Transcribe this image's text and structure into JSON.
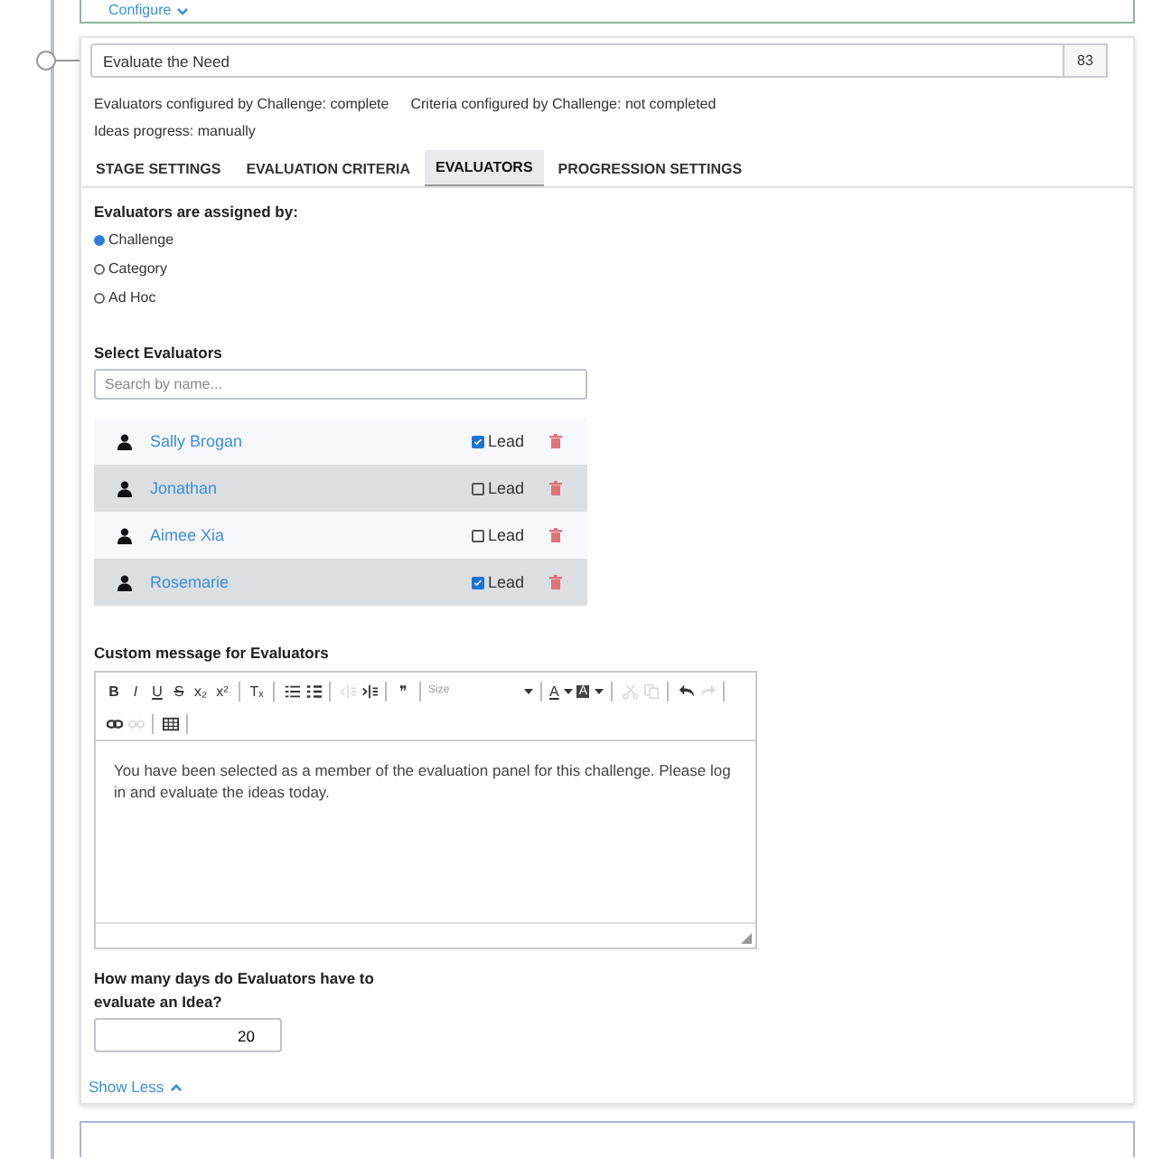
{
  "previous_card": {
    "link": "Configure"
  },
  "stage": {
    "title": "Evaluate the Need",
    "count": "83",
    "info": [
      "Evaluators configured by Challenge: complete",
      "Criteria configured by Challenge: not completed",
      "Ideas progress: manually"
    ],
    "tabs": [
      {
        "label": "STAGE SETTINGS",
        "selected": false
      },
      {
        "label": "EVALUATION CRITERIA",
        "selected": false
      },
      {
        "label": "EVALUATORS",
        "selected": true
      },
      {
        "label": "PROGRESSION SETTINGS",
        "selected": false
      }
    ],
    "assignment": {
      "label": "Evaluators are assigned by:",
      "options": [
        {
          "label": "Challenge",
          "selected": true
        },
        {
          "label": "Category",
          "selected": false
        },
        {
          "label": "Ad Hoc",
          "selected": false
        }
      ]
    },
    "select_label": "Select Evaluators",
    "search": {
      "placeholder": "Search by name..."
    },
    "evaluators": [
      {
        "name": "Sally Brogan",
        "lead": true,
        "lead_label": "Lead"
      },
      {
        "name": "Jonathan",
        "lead": false,
        "lead_label": "Lead"
      },
      {
        "name": "Aimee Xia",
        "lead": false,
        "lead_label": "Lead"
      },
      {
        "name": "Rosemarie",
        "lead": true,
        "lead_label": "Lead"
      }
    ],
    "message_label": "Custom message for Evaluators",
    "toolbar": [
      {
        "kind": "glyph",
        "label": "B",
        "disabled": false
      },
      {
        "kind": "glyph",
        "label": "I",
        "disabled": false
      },
      {
        "kind": "glyph",
        "label": "U",
        "disabled": false
      },
      {
        "kind": "glyph",
        "label": "S",
        "disabled": false
      },
      {
        "kind": "glyph",
        "label": "x₂",
        "disabled": false
      },
      {
        "kind": "glyph",
        "label": "x²",
        "disabled": false
      },
      {
        "kind": "sep"
      },
      {
        "kind": "glyph",
        "label": "Tₓ",
        "disabled": false
      },
      {
        "kind": "sep"
      },
      {
        "kind": "numbered",
        "disabled": false
      },
      {
        "kind": "bulleted",
        "disabled": false
      },
      {
        "kind": "sep"
      },
      {
        "kind": "outdent",
        "disabled": true
      },
      {
        "kind": "indent",
        "disabled": false
      },
      {
        "kind": "sep"
      },
      {
        "kind": "glyph",
        "label": "❞",
        "disabled": false
      },
      {
        "kind": "sep"
      },
      {
        "kind": "dropdown",
        "label": "Size",
        "disabled": false
      },
      {
        "kind": "sep"
      },
      {
        "kind": "color",
        "label": "A",
        "disabled": false
      },
      {
        "kind": "background",
        "label": "A",
        "disabled": false
      },
      {
        "kind": "sep"
      },
      {
        "kind": "cut",
        "disabled": true
      },
      {
        "kind": "copy",
        "disabled": true
      },
      {
        "kind": "sep"
      },
      {
        "kind": "undo",
        "disabled": false
      },
      {
        "kind": "redo",
        "disabled": true
      },
      {
        "kind": "sep"
      },
      {
        "kind": "break"
      },
      {
        "kind": "link",
        "disabled": false
      },
      {
        "kind": "unlink",
        "disabled": true
      },
      {
        "kind": "sep"
      },
      {
        "kind": "table",
        "disabled": false
      },
      {
        "kind": "sep"
      }
    ],
    "message": "You have been selected as a member of the evaluation panel for this challenge. Please log in and evaluate the ideas today.",
    "days_label": "How many days do Evaluators have to evaluate an Idea?",
    "days_value": "20",
    "show_less": "Show Less"
  }
}
